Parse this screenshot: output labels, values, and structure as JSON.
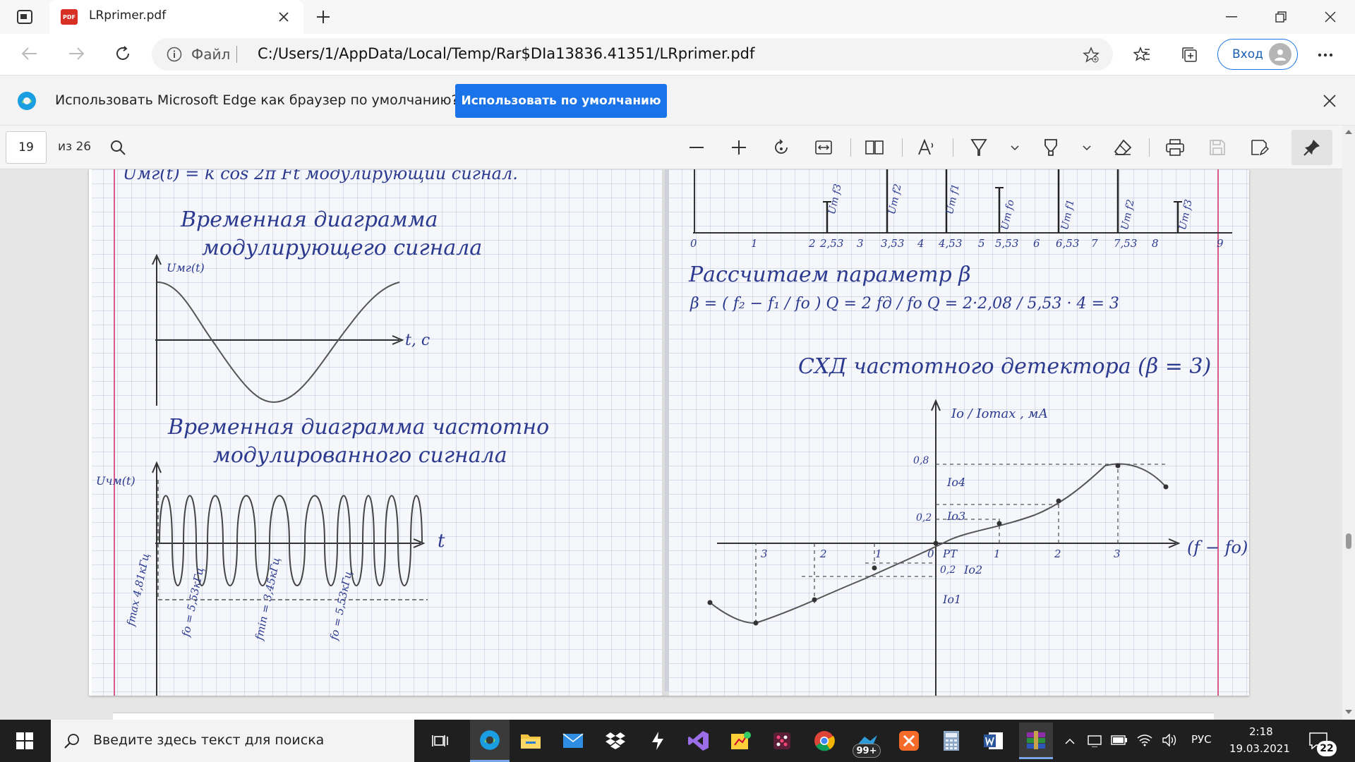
{
  "browser": {
    "tab": {
      "title": "LRprimer.pdf",
      "pdf_badge": "PDF"
    },
    "address": {
      "scheme_label": "Файл",
      "url": "C:/Users/1/AppData/Local/Temp/Rar$DIa13836.41351/LRprimer.pdf"
    },
    "profile_label": "Вход",
    "infobar": {
      "message": "Использовать Microsoft Edge как браузер по умолчанию?",
      "button": "Использовать по умолчанию"
    }
  },
  "pdf_toolbar": {
    "page_current": "19",
    "page_total": "из 26"
  },
  "page_left": {
    "heading_top": "Uмг(t) = k cos 2π Ft модулирующий сигнал.",
    "title1_line1": "Временная диаграмма",
    "title1_line2": "модулирующего сигнала",
    "plot1_ylabel": "Uмг(t)",
    "plot1_xlabel": "t, c",
    "title2_line1": "Временная диаграмма частотно",
    "title2_line2": "модулированного сигнала",
    "plot2_ylabel": "Uчм(t)",
    "plot2_xlabel": "t",
    "vlabels": [
      "fmax 4,81кГц",
      "fo = 5,53кГц",
      "fmin = 3,45кГц",
      "fo = 5,53кГц"
    ]
  },
  "page_right": {
    "spectrum_labels": [
      "Um f3",
      "Um f2",
      "Um f1",
      "Um fo",
      "Um f1",
      "Um f2",
      "Um f3"
    ],
    "axis_ticks": [
      "0",
      "1",
      "2",
      "2,53",
      "3",
      "3,53",
      "4",
      "4,53",
      "5",
      "5,53",
      "6",
      "6,53",
      "7",
      "7,53",
      "8",
      "9"
    ],
    "calc_title": "Рассчитаем параметр β",
    "formula": "β = ( f₂ − f₁ / fo ) Q = 2 fд / fo Q = 2·2,08 / 5,53 · 4 = 3",
    "chart_title": "СХД частотного детектора (β = 3)",
    "y_label": "Io / Iomax , мА",
    "x_label": "(f − fo)",
    "y_ticks": [
      "0,8",
      "0,2",
      "0,2"
    ],
    "x_ticks": [
      "3",
      "2",
      "1",
      "0",
      "1",
      "2",
      "3"
    ],
    "pt_label": "PT",
    "currents": [
      "Io4",
      "Io3",
      "Io2",
      "Io1"
    ]
  },
  "taskbar": {
    "search_placeholder": "Введите здесь текст для поиска",
    "badge_count": "99+",
    "language": "РУС",
    "time": "2:18",
    "date": "19.03.2021",
    "notifications": "22"
  }
}
